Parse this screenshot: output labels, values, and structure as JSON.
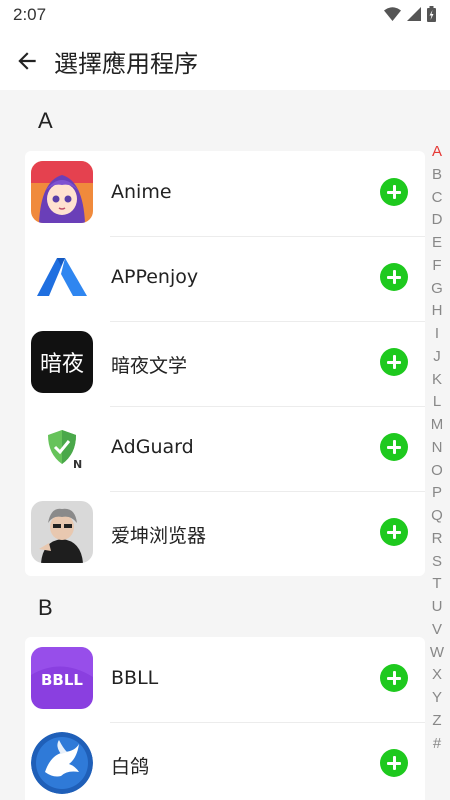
{
  "status_bar": {
    "time": "2:07"
  },
  "header": {
    "title": "選擇應用程序"
  },
  "sections": [
    {
      "letter": "A",
      "apps": [
        {
          "name": "Anime",
          "icon": "anime-app-icon"
        },
        {
          "name": "APPenjoy",
          "icon": "appenjoy-app-icon"
        },
        {
          "name": "暗夜文学",
          "icon": "anye-wenxue-app-icon",
          "icon_text": "暗夜"
        },
        {
          "name": "AdGuard",
          "icon": "adguard-app-icon",
          "icon_text": "N"
        },
        {
          "name": "爱坤浏览器",
          "icon": "aikun-browser-app-icon"
        }
      ]
    },
    {
      "letter": "B",
      "apps": [
        {
          "name": "BBLL",
          "icon": "bbll-app-icon",
          "icon_text": "BBLL"
        },
        {
          "name": "白鸽",
          "icon": "baige-app-icon"
        }
      ]
    }
  ],
  "index_bar": {
    "letters": [
      "A",
      "B",
      "C",
      "D",
      "E",
      "F",
      "G",
      "H",
      "I",
      "J",
      "K",
      "L",
      "M",
      "N",
      "O",
      "P",
      "Q",
      "R",
      "S",
      "T",
      "U",
      "V",
      "W",
      "X",
      "Y",
      "Z",
      "#"
    ],
    "active": "A"
  },
  "colors": {
    "accent_green": "#1ec91e",
    "index_active": "#e53935",
    "background": "#f5f5f5"
  }
}
